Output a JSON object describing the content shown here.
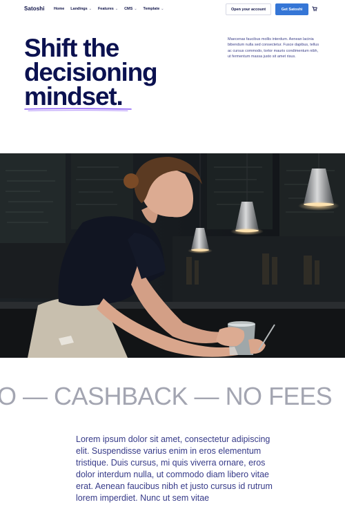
{
  "nav": {
    "logo": "Satoshi",
    "items": [
      {
        "label": "Home",
        "has_dropdown": false
      },
      {
        "label": "Landings",
        "has_dropdown": true
      },
      {
        "label": "Features",
        "has_dropdown": true
      },
      {
        "label": "CMS",
        "has_dropdown": true
      },
      {
        "label": "Template",
        "has_dropdown": true
      }
    ],
    "open_account_label": "Open your account",
    "get_label": "Get Satoshi",
    "cart_icon": "cart-icon"
  },
  "hero": {
    "headline_lines": [
      "Shift the",
      "decisioning",
      "mindset."
    ],
    "description": "Maecenas faucibus mollis interdum. Aenean lacinia bibendum nulla sed consectetur. Fusce dapibus, tellus ac cursus commodo, tortor mauris condimentum nibh, ut fermentum massa justo sit amet risus."
  },
  "photo": {
    "subject": "barista wiping a glass under pendant lamps"
  },
  "marquee": {
    "text": "O — CASHBACK — NO FEES"
  },
  "body": {
    "text": "Lorem ipsum dolor sit amet, consectetur adipiscing elit. Suspendisse varius enim in eros elementum tristique. Duis cursus, mi quis viverra ornare, eros dolor interdum nulla, ut commodo diam libero vitae erat. Aenean faucibus nibh et justo cursus id rutrum lorem imperdiet. Nunc ut sem vitae"
  },
  "colors": {
    "navy": "#0b1150",
    "accent": "#3576d6",
    "underline": "#8b5cf6",
    "marquee": "#a3a5b1"
  }
}
